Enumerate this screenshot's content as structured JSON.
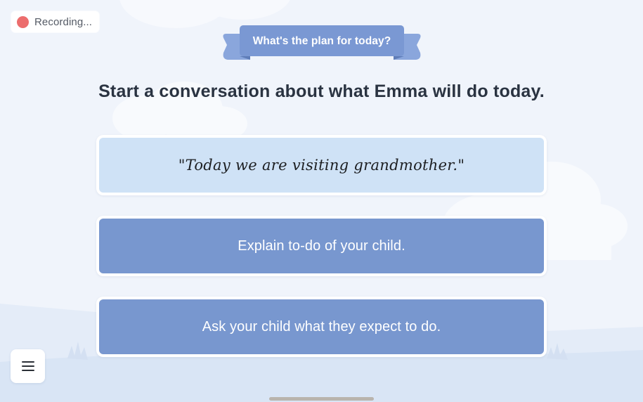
{
  "recording": {
    "label": "Recording...",
    "dot_color": "#ec6d6d"
  },
  "banner": {
    "label": "What's the plan for today?",
    "color": "#7a98d3"
  },
  "prompt": {
    "heading": "Start a conversation about what Emma will do today."
  },
  "options": [
    {
      "label": "\"Today we are visiting grandmother.\"",
      "style": "quote",
      "color": "#cfe2f6"
    },
    {
      "label": "Explain to-do of your child.",
      "style": "action",
      "color": "#7897cf"
    },
    {
      "label": "Ask your child what they expect to do.",
      "style": "action",
      "color": "#7897cf"
    }
  ],
  "menu": {
    "icon": "hamburger-menu-icon"
  },
  "theme": {
    "background": "#f0f4fb",
    "text_dark": "#2a3341",
    "hill_color": "#dbe6f6"
  }
}
